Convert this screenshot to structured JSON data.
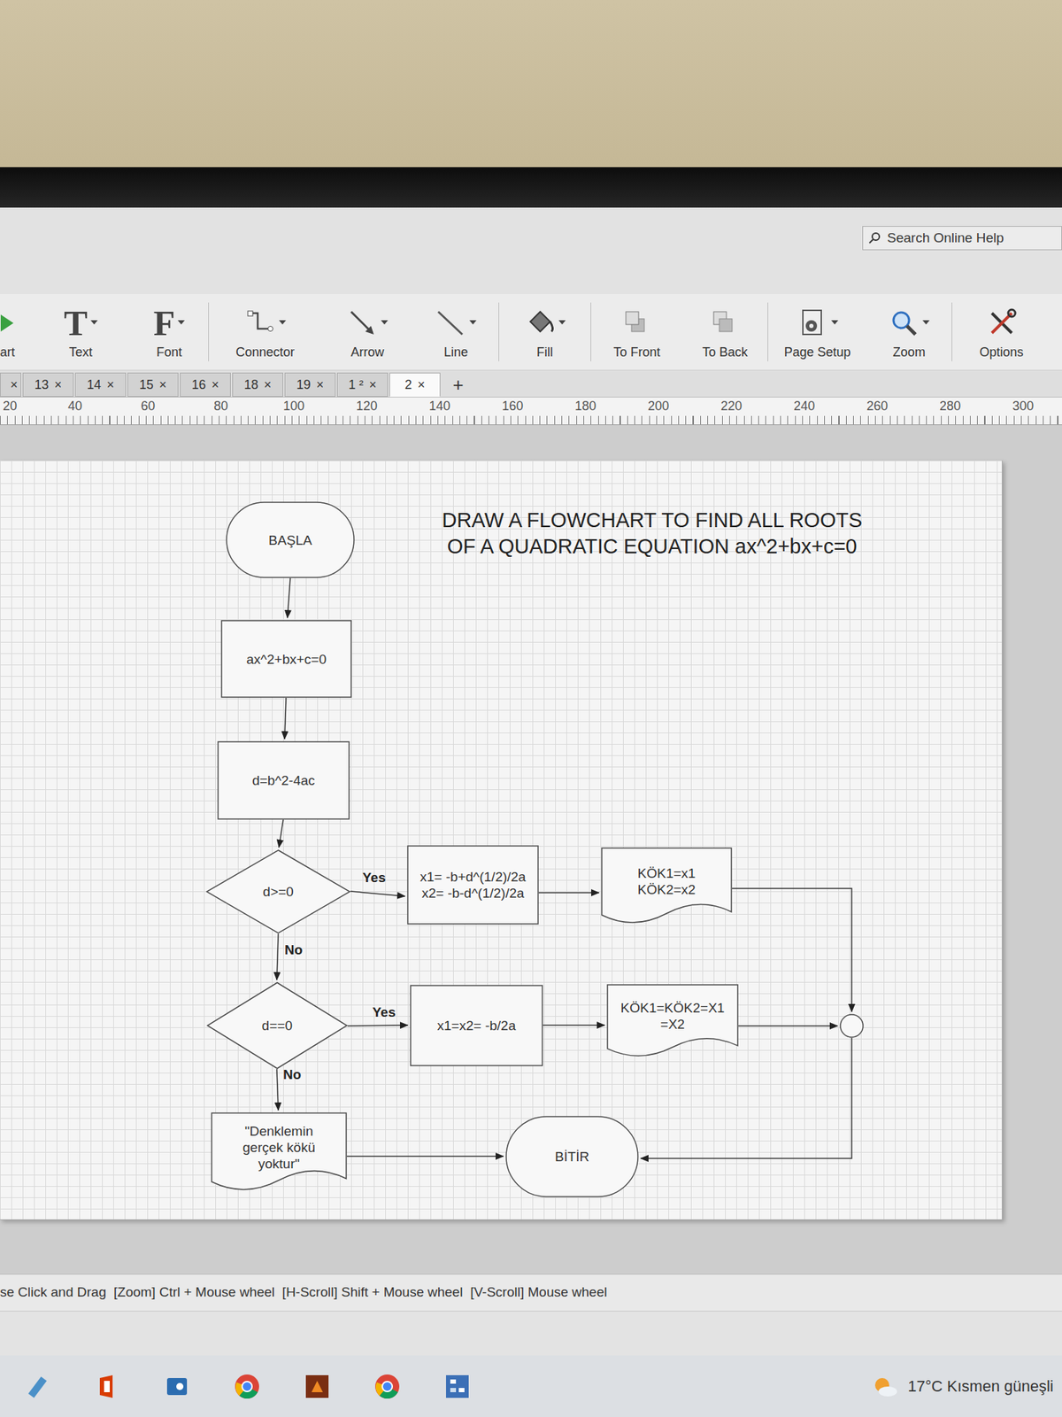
{
  "search": {
    "label": "Search Online Help"
  },
  "toolbar": [
    {
      "label": "art",
      "dropdown": false
    },
    {
      "label": "Text",
      "glyph": "T",
      "dropdown": true
    },
    {
      "label": "Font",
      "glyph": "F",
      "dropdown": true
    },
    {
      "label": "Connector",
      "dropdown": true
    },
    {
      "label": "Arrow",
      "dropdown": true
    },
    {
      "label": "Line",
      "dropdown": true
    },
    {
      "label": "Fill",
      "dropdown": true
    },
    {
      "label": "To Front",
      "dropdown": false
    },
    {
      "label": "To Back",
      "dropdown": false
    },
    {
      "label": "Page Setup",
      "dropdown": true
    },
    {
      "label": "Zoom",
      "dropdown": true
    },
    {
      "label": "Options",
      "dropdown": false
    }
  ],
  "tabs": {
    "cut_close": "×",
    "items": [
      {
        "label": "13",
        "close": "×",
        "selected": false
      },
      {
        "label": "14",
        "close": "×",
        "selected": false
      },
      {
        "label": "15",
        "close": "×",
        "selected": false
      },
      {
        "label": "16",
        "close": "×",
        "selected": false
      },
      {
        "label": "18",
        "close": "×",
        "selected": false
      },
      {
        "label": "19",
        "close": "×",
        "selected": false
      },
      {
        "label": "1 ²",
        "close": "×",
        "selected": false
      },
      {
        "label": "2",
        "close": "×",
        "selected": true
      }
    ],
    "add": "+"
  },
  "ruler": [
    "20",
    "40",
    "60",
    "80",
    "100",
    "120",
    "140",
    "160",
    "180",
    "200",
    "220",
    "240",
    "260",
    "280",
    "300"
  ],
  "diagram": {
    "title_lines": [
      "DRAW A FLOWCHART TO FIND ALL ROOTS",
      "OF A QUADRATIC EQUATION ax^2+bx+c=0"
    ],
    "nodes": [
      {
        "kind": "terminator",
        "lines": [
          "BAŞLA"
        ]
      },
      {
        "kind": "process",
        "lines": [
          "ax^2+bx+c=0"
        ]
      },
      {
        "kind": "process",
        "lines": [
          "d=b^2-4ac"
        ]
      },
      {
        "kind": "decision",
        "lines": [
          "d>=0"
        ]
      },
      {
        "kind": "process",
        "lines": [
          "x1= -b+d^(1/2)/2a",
          "x2= -b-d^(1/2)/2a"
        ]
      },
      {
        "kind": "document",
        "lines": [
          "KÖK1=x1",
          "KÖK2=x2"
        ]
      },
      {
        "kind": "decision",
        "lines": [
          "d==0"
        ]
      },
      {
        "kind": "process",
        "lines": [
          "x1=x2= -b/2a"
        ]
      },
      {
        "kind": "document",
        "lines": [
          "KÖK1=KÖK2=X1",
          "=X2"
        ]
      },
      {
        "kind": "connector",
        "lines": []
      },
      {
        "kind": "document",
        "lines": [
          "\"Denklemin",
          "gerçek kökü",
          "yoktur\""
        ]
      },
      {
        "kind": "terminator",
        "lines": [
          "BİTİR"
        ]
      }
    ],
    "edge_labels": [
      "Yes",
      "No",
      "Yes",
      "No"
    ]
  },
  "status_bar": "se Click and Drag  [Zoom] Ctrl + Mouse wheel  [H-Scroll] Shift + Mouse wheel  [V-Scroll] Mouse wheel",
  "taskbar": {
    "weather": "17°C  Kısmen güneşli"
  }
}
